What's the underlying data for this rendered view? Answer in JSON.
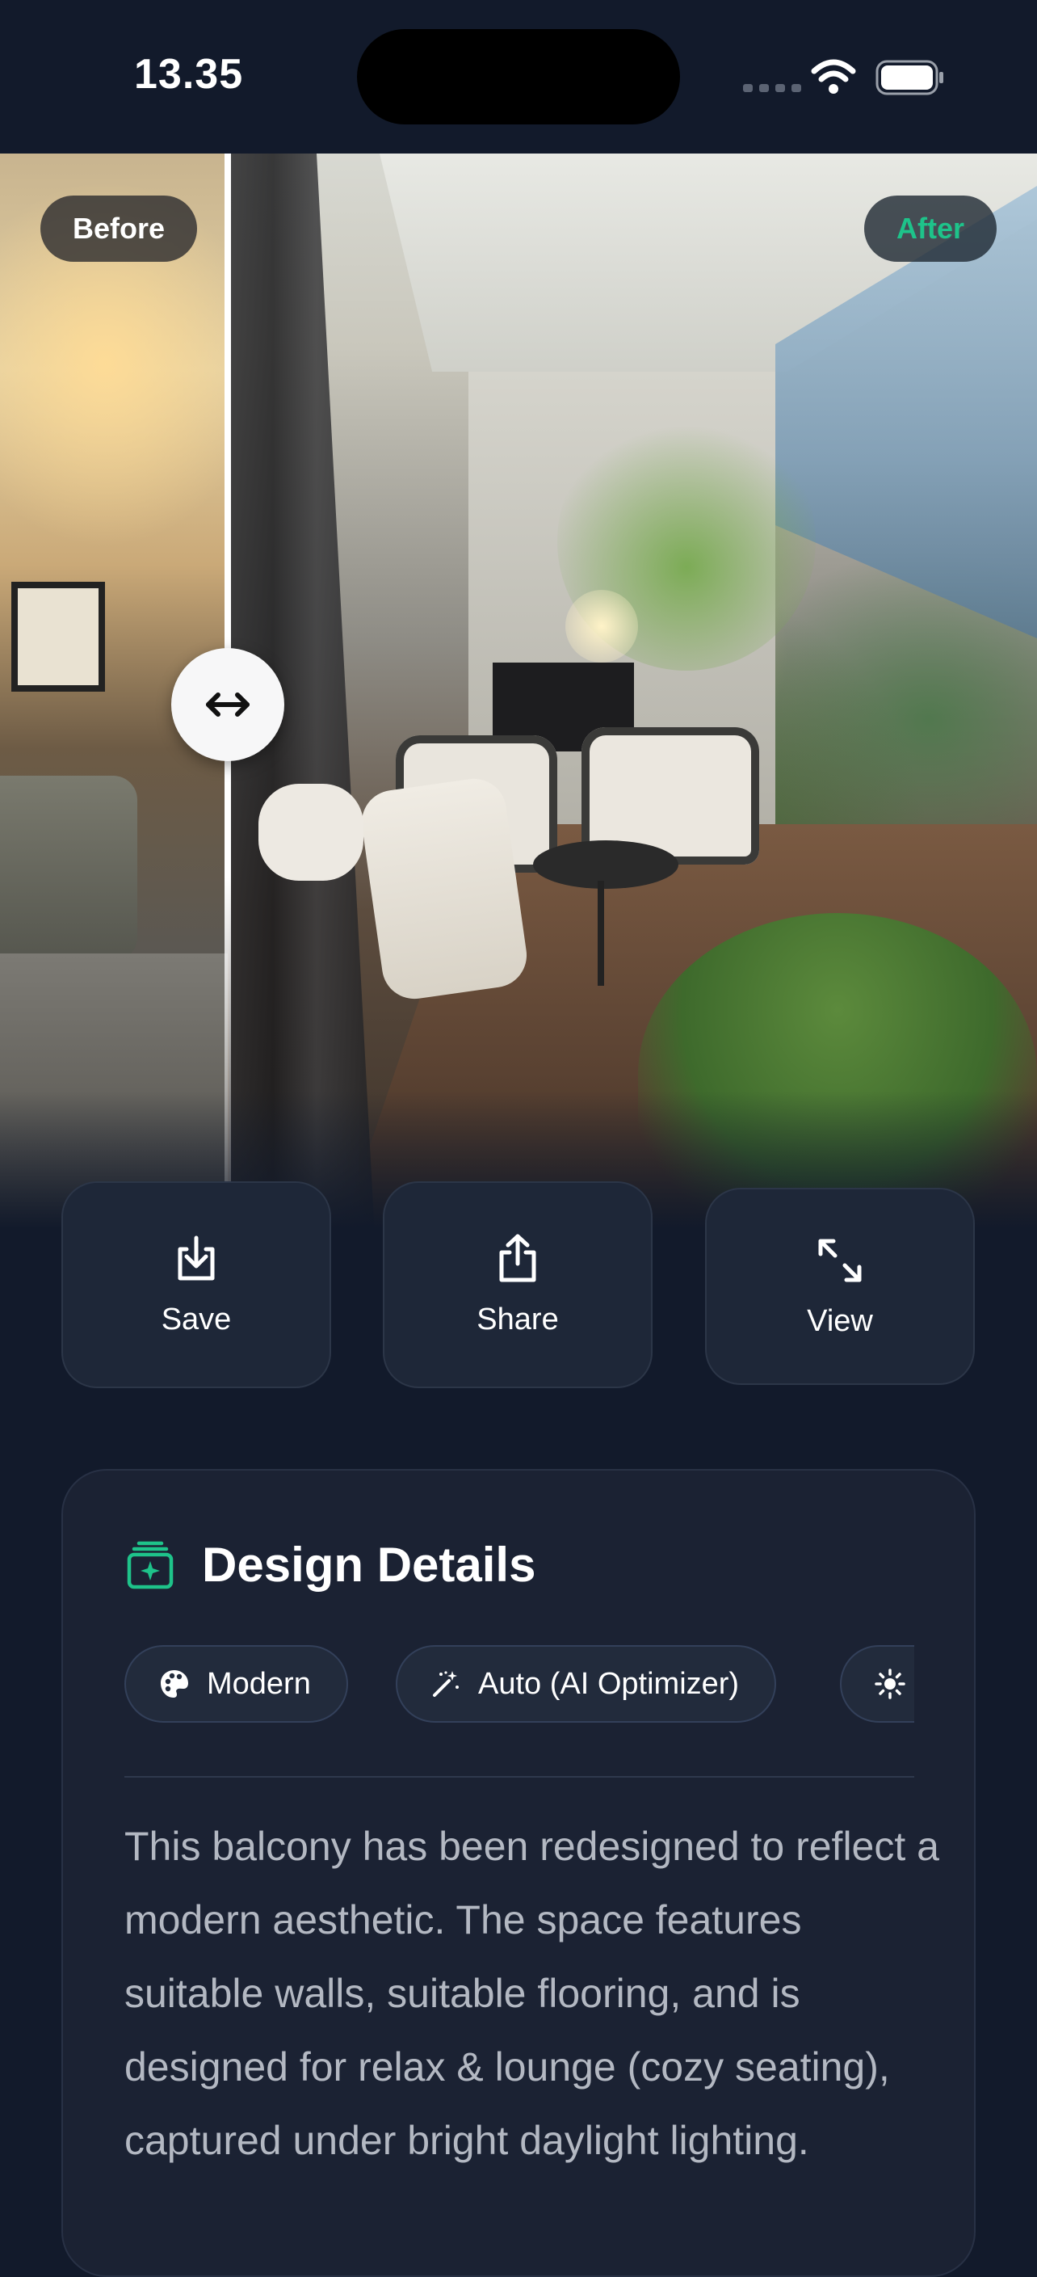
{
  "status_bar": {
    "time": "13.35"
  },
  "compare": {
    "before_label": "Before",
    "after_label": "After",
    "slider_position": 0.22
  },
  "actions": [
    {
      "id": "save",
      "label": "Save",
      "icon": "download-icon"
    },
    {
      "id": "share",
      "label": "Share",
      "icon": "share-icon"
    },
    {
      "id": "view",
      "label": "View",
      "icon": "expand-icon"
    }
  ],
  "details": {
    "title": "Design Details",
    "title_icon": "design-box-icon",
    "chips": [
      {
        "label": "Modern",
        "icon": "palette-icon"
      },
      {
        "label": "Auto (AI Optimizer)",
        "icon": "magic-wand-icon"
      },
      {
        "label": "",
        "icon": "sun-icon"
      }
    ],
    "description": "This balcony has been redesigned to reflect a modern aesthetic. The space features suitable walls, suitable flooring, and is designed for relax & lounge (cozy seating), captured under bright daylight lighting."
  },
  "colors": {
    "background": "#121a2b",
    "accent": "#1ec38a",
    "card": "#1b2233"
  }
}
